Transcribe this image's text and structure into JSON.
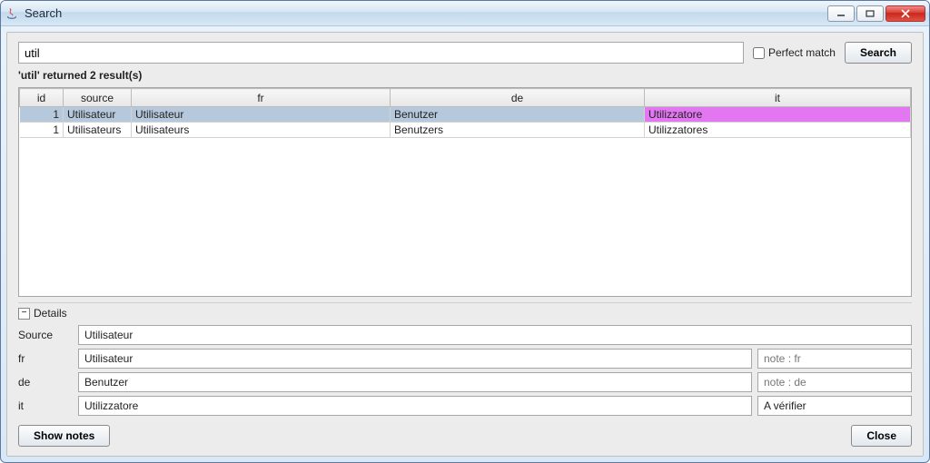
{
  "window": {
    "title": "Search"
  },
  "search": {
    "value": "util",
    "perfect_match_label": "Perfect match",
    "perfect_match_checked": false,
    "button_label": "Search"
  },
  "results": {
    "status": "'util' returned 2 result(s)",
    "columns": [
      "id",
      "source",
      "fr",
      "de",
      "it"
    ],
    "rows": [
      {
        "id": "1",
        "source": "Utilisateur",
        "fr": "Utilisateur",
        "de": "Benutzer",
        "it": "Utilizzatore",
        "selected": true,
        "highlight_col": "it"
      },
      {
        "id": "1",
        "source": "Utilisateurs",
        "fr": "Utilisateurs",
        "de": "Benutzers",
        "it": "Utilizzatores",
        "selected": false
      }
    ]
  },
  "details": {
    "panel_label": "Details",
    "source_label": "Source",
    "source_value": "Utilisateur",
    "fr_label": "fr",
    "fr_value": "Utilisateur",
    "fr_note_placeholder": "note : fr",
    "de_label": "de",
    "de_value": "Benutzer",
    "de_note_placeholder": "note : de",
    "it_label": "it",
    "it_value": "Utilizzatore",
    "it_note_value": "A vérifier"
  },
  "buttons": {
    "show_notes": "Show notes",
    "close": "Close"
  }
}
